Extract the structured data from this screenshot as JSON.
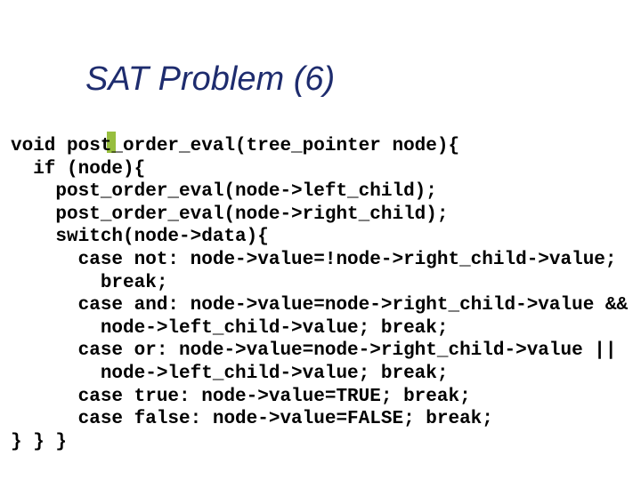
{
  "title": "SAT Problem (6)",
  "code": {
    "l1": "void post_order_eval(tree_pointer node){",
    "l2": "  if (node){",
    "l3": "    post_order_eval(node->left_child);",
    "l4": "    post_order_eval(node->right_child);",
    "l5": "    switch(node->data){",
    "l6": "      case not: node->value=!node->right_child->value;",
    "l7": "        break;",
    "l8": "      case and: node->value=node->right_child->value &&",
    "l9": "        node->left_child->value; break;",
    "l10": "      case or: node->value=node->right_child->value ||",
    "l11": "        node->left_child->value; break;",
    "l12": "      case true: node->value=TRUE; break;",
    "l13": "      case false: node->value=FALSE; break;",
    "l14": "} } }"
  }
}
